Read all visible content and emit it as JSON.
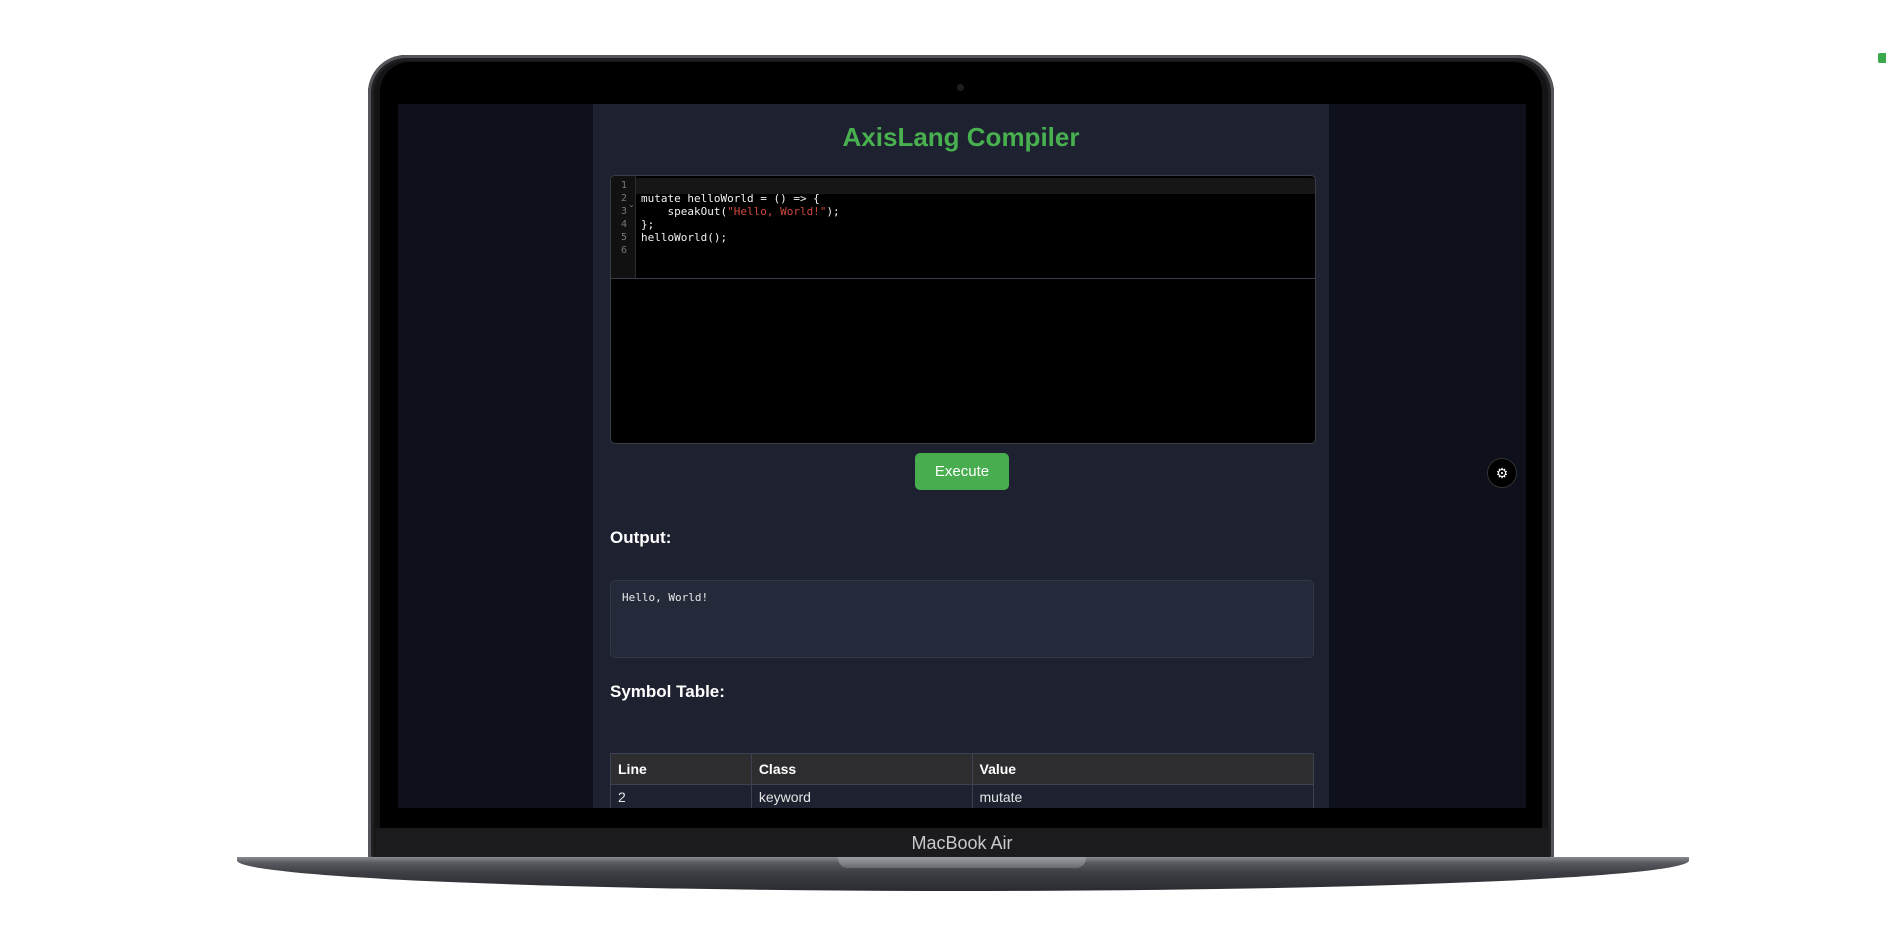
{
  "app": {
    "title": "AxisLang Compiler"
  },
  "editor": {
    "line_numbers": [
      "1",
      "2",
      "3",
      "4",
      "5",
      "6"
    ],
    "lines": {
      "l2": "mutate helloWorld = () => {",
      "l3_pre": "    speakOut(",
      "l3_str": "\"Hello, World!\"",
      "l3_post": ");",
      "l4": "};",
      "l5": "helloWorld();"
    }
  },
  "execute_label": "Execute",
  "output": {
    "heading": "Output:",
    "text": "Hello, World!"
  },
  "symbol_table": {
    "heading": "Symbol Table:",
    "headers": [
      "Line",
      "Class",
      "Value"
    ],
    "rows": [
      [
        "2",
        "keyword",
        "mutate"
      ]
    ]
  },
  "device": {
    "label": "MacBook Air"
  },
  "colors": {
    "accent": "#48b04f",
    "panel": "#1d2130",
    "screen_bg": "#0e111b"
  }
}
